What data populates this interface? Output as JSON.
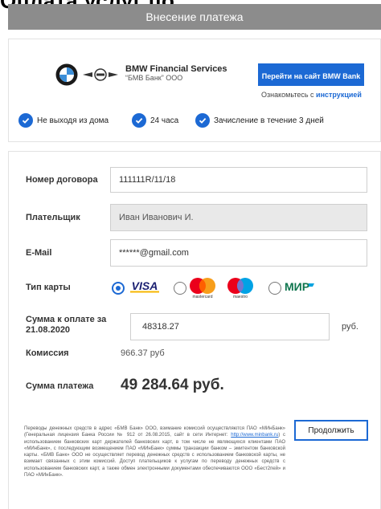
{
  "page": {
    "top_title": "Оплата услуг по",
    "header_title": "Внесение платежа"
  },
  "partner": {
    "name": "BMW Financial Services",
    "subtitle": "“БМВ Банк” ООО",
    "goto_button": "Перейти на сайт BMW Bank",
    "instruction_prefix": "Ознакомьтесь с ",
    "instruction_link": "инструкцией"
  },
  "features": [
    "Не выходя из дома",
    "24 часа",
    "Зачисление в течение 3 дней"
  ],
  "form": {
    "contract": {
      "label": "Номер договора",
      "value": "111111R/11/18"
    },
    "payer": {
      "label": "Плательщик",
      "value": "Иван Иванович И."
    },
    "email": {
      "label": "E-Mail",
      "value": "******@gmail.com"
    },
    "card_type": {
      "label": "Тип карты",
      "options": [
        "VISA",
        "mastercard",
        "maestro",
        "МИР"
      ],
      "selected": "VISA"
    },
    "amount": {
      "label": "Сумма к оплате за 21.08.2020",
      "value": "48318.27",
      "suffix": "руб."
    },
    "commission": {
      "label": "Комиссия",
      "value": "966.37 руб"
    },
    "total": {
      "label": "Сумма платежа",
      "value": "49 284.64 руб."
    }
  },
  "legal": {
    "text_before": "Переводы денежных средств в адрес «БМВ Банк» ООО, взимание комиссий осуществляются ПАО «МИнБанк» (Генеральная лицензия Банка России № 912 от 26.08.2015, сайт в сети Интернет: ",
    "link": "http://www.minbank.ru",
    "text_after": ") с использованием банковских карт держателей банковских карт, в том числе не являющихся клиентами ПАО «МИнБанк», с последующим возмещением ПАО «МИнБанк» суммы транзакции банком – эмитентом банковской карты. «БМВ Банк» ООО не осуществляет перевод денежных средств с использованием банковской карты, не взимает связанных с этим комиссий. Доступ плательщиков к услугам по переводу денежных средств с использованием банковских карт, а также обмен электронными документами обеспечиваются ООО «Бест2пей» и ПАО «МИнБанк»."
  },
  "actions": {
    "continue": "Продолжить"
  },
  "colors": {
    "accent": "#1c69d4",
    "header_bg": "#8c8c8c"
  }
}
